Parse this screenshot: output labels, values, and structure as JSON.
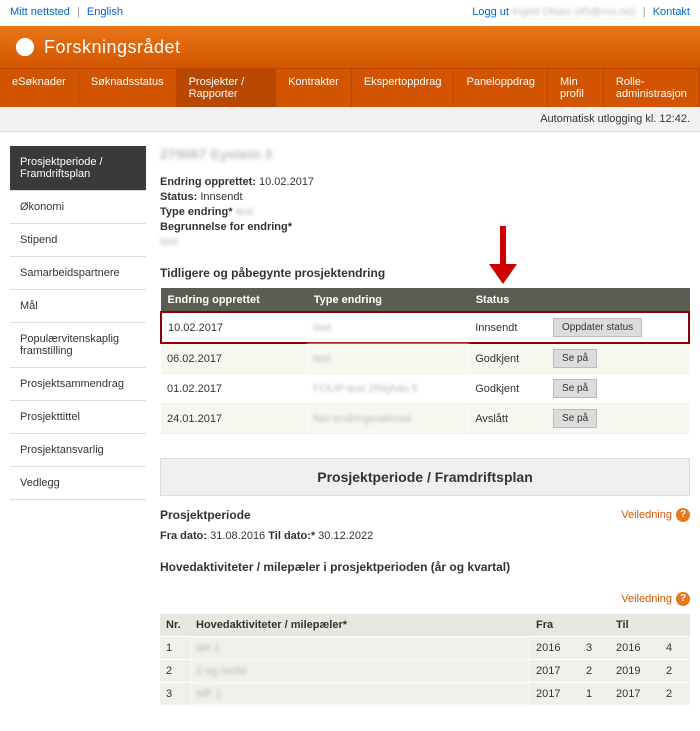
{
  "topbar": {
    "mitt": "Mitt nettsted",
    "lang": "English",
    "loggut": "Logg ut",
    "user": "Ingrid Olsen (45@rcn.no)",
    "kontakt": "Kontakt"
  },
  "brand": "Forskningsrådet",
  "nav": [
    "eSøknader",
    "Søknadsstatus",
    "Prosjekter / Rapporter",
    "Kontrakter",
    "Ekspertoppdrag",
    "Paneloppdrag",
    "Min profil",
    "Rolle- administrasjon"
  ],
  "nav_active": 2,
  "autologout": "Automatisk utlogging kl. 12:42.",
  "sidebar": [
    "Prosjektperiode / Framdriftsplan",
    "Økonomi",
    "Stipend",
    "Samarbeidspartnere",
    "Mål",
    "Populærvitenskaplig framstilling",
    "Prosjektsammendrag",
    "Prosjekttittel",
    "Prosjektansvarlig",
    "Vedlegg"
  ],
  "sidebar_active": 0,
  "project_title": "279067 Eystein 3",
  "meta": {
    "endring_opp_label": "Endring opprettet:",
    "endring_opp_val": "10.02.2017",
    "status_label": "Status:",
    "status_val": "Innsendt",
    "type_label": "Type endring*",
    "type_val": "test",
    "begr_label": "Begrunnelse for endring*",
    "begr_val": "test"
  },
  "changes_title": "Tidligere og påbegynte prosjektendring",
  "changes_headers": [
    "Endring opprettet",
    "Type endring",
    "Status",
    ""
  ],
  "changes_rows": [
    {
      "date": "10.02.2017",
      "type": "test",
      "status": "Innsendt",
      "action": "Oppdater status",
      "highlighted": true
    },
    {
      "date": "06.02.2017",
      "type": "test",
      "status": "Godkjent",
      "action": "Se på"
    },
    {
      "date": "01.02.2017",
      "type": "FOUP-test 2Rkjhdo 5",
      "status": "Godkjent",
      "action": "Se på"
    },
    {
      "date": "24.01.2017",
      "type": "Nei endringssøknad",
      "status": "Avslått",
      "action": "Se på"
    }
  ],
  "panel_title": "Prosjektperiode / Framdriftsplan",
  "veiledning": "Veiledning",
  "period": {
    "heading": "Prosjektperiode",
    "fra_label": "Fra dato:",
    "fra_val": "31.08.2016",
    "til_label": "Til dato:*",
    "til_val": "30.12.2022"
  },
  "milestones_heading": "Hovedaktiviteter / milepæler i prosjektperioden (år og kvartal)",
  "milestones_headers": {
    "nr": "Nr.",
    "act": "Hovedaktiviteter / milepæler*",
    "fra": "Fra",
    "til": "Til"
  },
  "milestones": [
    {
      "nr": "1",
      "act": "akt 1",
      "fy": "2016",
      "fq": "3",
      "ty": "2016",
      "tq": "4"
    },
    {
      "nr": "2",
      "act": "2 og neste",
      "fy": "2017",
      "fq": "2",
      "ty": "2019",
      "tq": "2"
    },
    {
      "nr": "3",
      "act": "MP 1",
      "fy": "2017",
      "fq": "1",
      "ty": "2017",
      "tq": "2"
    }
  ]
}
